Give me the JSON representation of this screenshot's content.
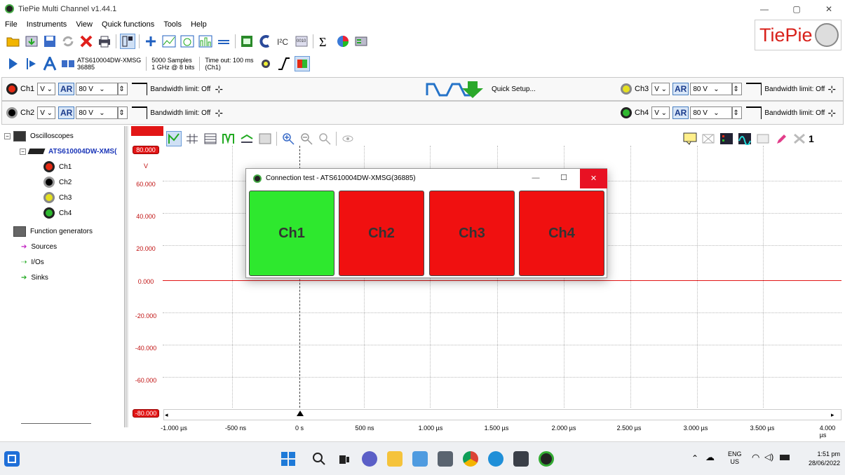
{
  "window": {
    "title": "TiePie Multi Channel v1.44.1",
    "brand": "TiePie"
  },
  "menu": [
    "File",
    "Instruments",
    "View",
    "Quick functions",
    "Tools",
    "Help"
  ],
  "status": {
    "device": "ATS610004DW-XMSG",
    "serial": "36885",
    "samples": "5000 Samples",
    "rate": "1 GHz @ 8 bits",
    "timeout": "Time out: 100 ms",
    "ch": "(Ch1)"
  },
  "channels": [
    {
      "name": "Ch1",
      "range": "80 V",
      "bw": "Bandwidth limit: Off",
      "color": "#e52b14"
    },
    {
      "name": "Ch2",
      "range": "80 V",
      "bw": "Bandwidth limit: Off",
      "color": "#000000"
    },
    {
      "name": "Ch3",
      "range": "80 V",
      "bw": "Bandwidth limit: Off",
      "color": "#e5e020"
    },
    {
      "name": "Ch4",
      "range": "80 V",
      "bw": "Bandwidth limit: Off",
      "color": "#2fb82f"
    }
  ],
  "quick_setup": "Quick Setup...",
  "ar_label": "AR",
  "tree": {
    "oscilloscopes": "Oscilloscopes",
    "device": "ATS610004DW-XMS(",
    "channels": [
      "Ch1",
      "Ch2",
      "Ch3",
      "Ch4"
    ],
    "function_generators": "Function generators",
    "sources": "Sources",
    "ios": "I/Os",
    "sinks": "Sinks"
  },
  "plot": {
    "y_labels": [
      "80.000",
      "V",
      "60.000",
      "40.000",
      "20.000",
      "0.000",
      "-20.000",
      "-40.000",
      "-60.000",
      "-80.000"
    ],
    "x_labels": [
      "-1.000 µs",
      "-500 ns",
      "0 s",
      "500 ns",
      "1.000 µs",
      "1.500 µs",
      "2.000 µs",
      "2.500 µs",
      "3.000 µs",
      "3.500 µs",
      "4.000 µs"
    ],
    "graph_num": "1"
  },
  "dialog": {
    "title": "Connection test - ATS610004DW-XMSG(36885)",
    "tiles": [
      {
        "label": "Ch1",
        "color": "#2ee82e"
      },
      {
        "label": "Ch2",
        "color": "#f01010"
      },
      {
        "label": "Ch3",
        "color": "#f01010"
      },
      {
        "label": "Ch4",
        "color": "#f01010"
      }
    ]
  },
  "taskbar": {
    "lang": "ENG",
    "region": "US",
    "time": "1:51 pm",
    "date": "28/06/2022"
  }
}
